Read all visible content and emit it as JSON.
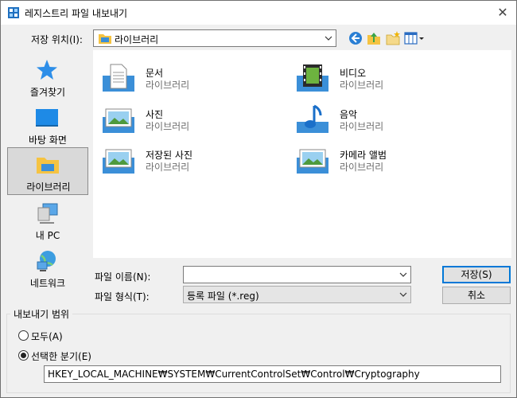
{
  "window": {
    "title": "레지스트리 파일 내보내기",
    "close_glyph": "✕"
  },
  "location": {
    "label": "저장 위치(I):",
    "value": "라이브러리"
  },
  "sidebar": {
    "items": [
      {
        "label": "즐겨찾기",
        "icon": "favorites-star-icon",
        "selected": false
      },
      {
        "label": "바탕 화면",
        "icon": "desktop-icon",
        "selected": false
      },
      {
        "label": "라이브러리",
        "icon": "libraries-folder-icon",
        "selected": true
      },
      {
        "label": "내 PC",
        "icon": "this-pc-icon",
        "selected": false
      },
      {
        "label": "네트워크",
        "icon": "network-icon",
        "selected": false
      }
    ]
  },
  "files": [
    {
      "name": "문서",
      "sub": "라이브러리",
      "icon": "documents-library-icon"
    },
    {
      "name": "비디오",
      "sub": "라이브러리",
      "icon": "videos-library-icon"
    },
    {
      "name": "사진",
      "sub": "라이브러리",
      "icon": "pictures-library-icon"
    },
    {
      "name": "음악",
      "sub": "라이브러리",
      "icon": "music-library-icon"
    },
    {
      "name": "저장된 사진",
      "sub": "라이브러리",
      "icon": "saved-pictures-library-icon"
    },
    {
      "name": "카메라 앨범",
      "sub": "라이브러리",
      "icon": "camera-roll-library-icon"
    }
  ],
  "filename": {
    "label": "파일 이름(N):",
    "value": ""
  },
  "filetype": {
    "label": "파일 형식(T):",
    "value": "등록 파일 (*.reg)"
  },
  "buttons": {
    "save": "저장(S)",
    "cancel": "취소"
  },
  "export_range": {
    "title": "내보내기 범위",
    "all_label": "모두(A)",
    "selected_label": "선택한 분기(E)",
    "selected_checked": true,
    "branch_path": "HKEY_LOCAL_MACHINE₩SYSTEM₩CurrentControlSet₩Control₩Cryptography"
  },
  "colors": {
    "accent": "#0078d7",
    "selected_bg": "#d9d9d9"
  }
}
